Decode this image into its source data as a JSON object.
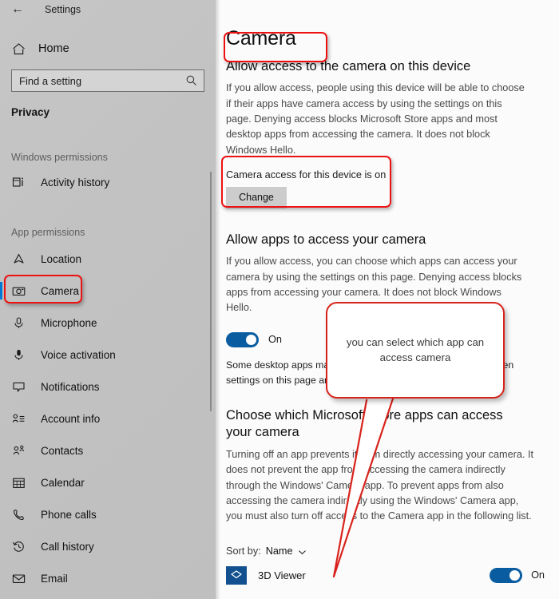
{
  "window": {
    "back_label": "back-arrow",
    "app_title": "Settings"
  },
  "sidebar": {
    "home_label": "Home",
    "search": {
      "placeholder": "Find a setting",
      "value": ""
    },
    "category": "Privacy",
    "groups": [
      {
        "heading": "Windows permissions",
        "items": [
          {
            "label": "Activity history",
            "icon": "activity-history-icon",
            "selected": false
          }
        ]
      },
      {
        "heading": "App permissions",
        "items": [
          {
            "label": "Location",
            "icon": "location-icon",
            "selected": false
          },
          {
            "label": "Camera",
            "icon": "camera-icon",
            "selected": true
          },
          {
            "label": "Microphone",
            "icon": "microphone-icon",
            "selected": false
          },
          {
            "label": "Voice activation",
            "icon": "voice-activation-icon",
            "selected": false
          },
          {
            "label": "Notifications",
            "icon": "notifications-icon",
            "selected": false
          },
          {
            "label": "Account info",
            "icon": "account-info-icon",
            "selected": false
          },
          {
            "label": "Contacts",
            "icon": "contacts-icon",
            "selected": false
          },
          {
            "label": "Calendar",
            "icon": "calendar-icon",
            "selected": false
          },
          {
            "label": "Phone calls",
            "icon": "phone-calls-icon",
            "selected": false
          },
          {
            "label": "Call history",
            "icon": "call-history-icon",
            "selected": false
          },
          {
            "label": "Email",
            "icon": "email-icon",
            "selected": false
          }
        ]
      }
    ]
  },
  "main": {
    "page_title": "Camera",
    "device_section": {
      "heading": "Allow access to the camera on this device",
      "description": "If you allow access, people using this device will be able to choose if their apps have camera access by using the settings on this page. Denying access blocks Microsoft Store apps and most desktop apps from accessing the camera. It does not block Windows Hello.",
      "status": "Camera access for this device is on",
      "change_button": "Change"
    },
    "apps_section": {
      "heading": "Allow apps to access your camera",
      "description": "If you allow access, you can choose which apps can access your camera by using the settings on this page. Denying access blocks apps from accessing your camera. It does not block Windows Hello.",
      "toggle_state": "On",
      "note": "Some desktop apps may still be able to access your camera when settings on this page are off."
    },
    "store_section": {
      "heading": "Choose which Microsoft Store apps can access your camera",
      "description": "Turning off an app prevents it from directly accessing your camera. It does not prevent the app from accessing the camera indirectly through the Windows' Camera app. To prevent apps from also accessing the camera indirectly using the Windows' Camera app, you must also turn off access to the Camera app in the following list.",
      "sort_label": "Sort by:",
      "sort_value": "Name",
      "apps": [
        {
          "name": "3D Viewer",
          "state": "On"
        }
      ]
    }
  },
  "annotations": {
    "callout_text": "you can select which app can access camera",
    "highlight_color": "#ee1111",
    "callout_border_color": "#d8231c",
    "accent_color": "#0078d4",
    "toggle_on_color": "#0a5ca0"
  }
}
